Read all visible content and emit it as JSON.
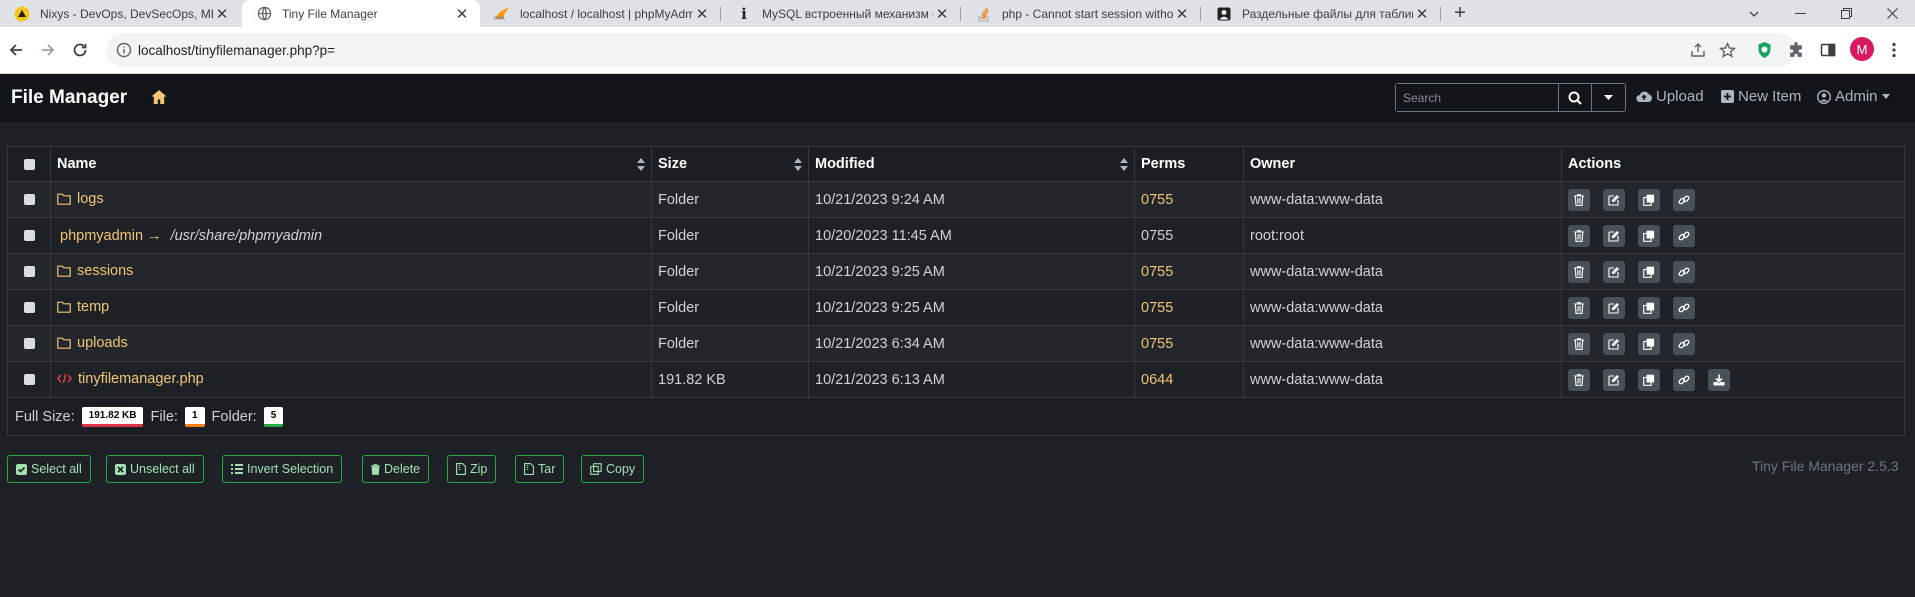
{
  "browser": {
    "tabs": [
      {
        "title": "Nixys - DevOps, DevSecOps, MLOps",
        "active": false,
        "favicon": "nixys-icon"
      },
      {
        "title": "Tiny File Manager",
        "active": true,
        "favicon": "globe-icon"
      },
      {
        "title": "localhost / localhost | phpMyAdmin",
        "active": false,
        "favicon": "phpmyadmin-icon"
      },
      {
        "title": "MySQL встроенный механизм сохранения",
        "active": false,
        "favicon": "info-icon"
      },
      {
        "title": "php - Cannot start session without errors",
        "active": false,
        "favicon": "stackoverflow-icon"
      },
      {
        "title": "Раздельные файлы для таблиц InnoDB",
        "active": false,
        "favicon": "page-icon"
      }
    ],
    "url": "localhost/tinyfilemanager.php?p=",
    "profile_initial": "M"
  },
  "header": {
    "brand": "File Manager",
    "search_placeholder": "Search",
    "upload_label": "Upload",
    "new_item_label": "New Item",
    "admin_label": "Admin"
  },
  "table": {
    "columns": [
      "Name",
      "Size",
      "Modified",
      "Perms",
      "Owner",
      "Actions"
    ],
    "rows": [
      {
        "name": "logs",
        "type": "folder",
        "size": "Folder",
        "modified": "10/21/2023 9:24 AM",
        "perms": "0755",
        "owner": "www-data:www-data"
      },
      {
        "name": "phpmyadmin →",
        "target": "/usr/share/phpmyadmin",
        "type": "symlink",
        "size": "Folder",
        "modified": "10/20/2023 11:45 AM",
        "perms": "0755",
        "owner": "root:root"
      },
      {
        "name": "sessions",
        "type": "folder",
        "size": "Folder",
        "modified": "10/21/2023 9:25 AM",
        "perms": "0755",
        "owner": "www-data:www-data"
      },
      {
        "name": "temp",
        "type": "folder",
        "size": "Folder",
        "modified": "10/21/2023 9:25 AM",
        "perms": "0755",
        "owner": "www-data:www-data"
      },
      {
        "name": "uploads",
        "type": "folder",
        "size": "Folder",
        "modified": "10/21/2023 6:34 AM",
        "perms": "0755",
        "owner": "www-data:www-data"
      },
      {
        "name": "tinyfilemanager.php",
        "type": "file",
        "size": "191.82 KB",
        "modified": "10/21/2023 6:13 AM",
        "perms": "0644",
        "owner": "www-data:www-data"
      }
    ],
    "footer": {
      "full_size_label": "Full Size:",
      "full_size": "191.82 KB",
      "file_label": "File:",
      "file_count": "1",
      "folder_label": "Folder:",
      "folder_count": "5"
    }
  },
  "actions": {
    "select_all": "Select all",
    "unselect_all": "Unselect all",
    "invert_selection": "Invert Selection",
    "delete": "Delete",
    "zip": "Zip",
    "tar": "Tar",
    "copy": "Copy"
  },
  "version": "Tiny File Manager 2.5.3",
  "colors": {
    "header_bg": "#121519",
    "page_bg": "#1e2227",
    "link": "#f0c674",
    "success": "#28a745"
  }
}
